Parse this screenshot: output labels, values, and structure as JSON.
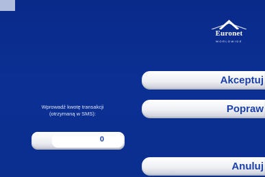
{
  "logo": {
    "brand": "Euronet",
    "tagline": "WORLDWIDE"
  },
  "buttons": {
    "accept": "Akceptuj",
    "correct": "Popraw",
    "cancel": "Anuluj"
  },
  "prompt": {
    "line1": "Wprowadź kwotę transakcji",
    "line2": "(otrzymaną w SMS):"
  },
  "amount_field": {
    "value": "0"
  },
  "colors": {
    "background": "#0b2f93",
    "button_text": "#1a3fa8"
  }
}
